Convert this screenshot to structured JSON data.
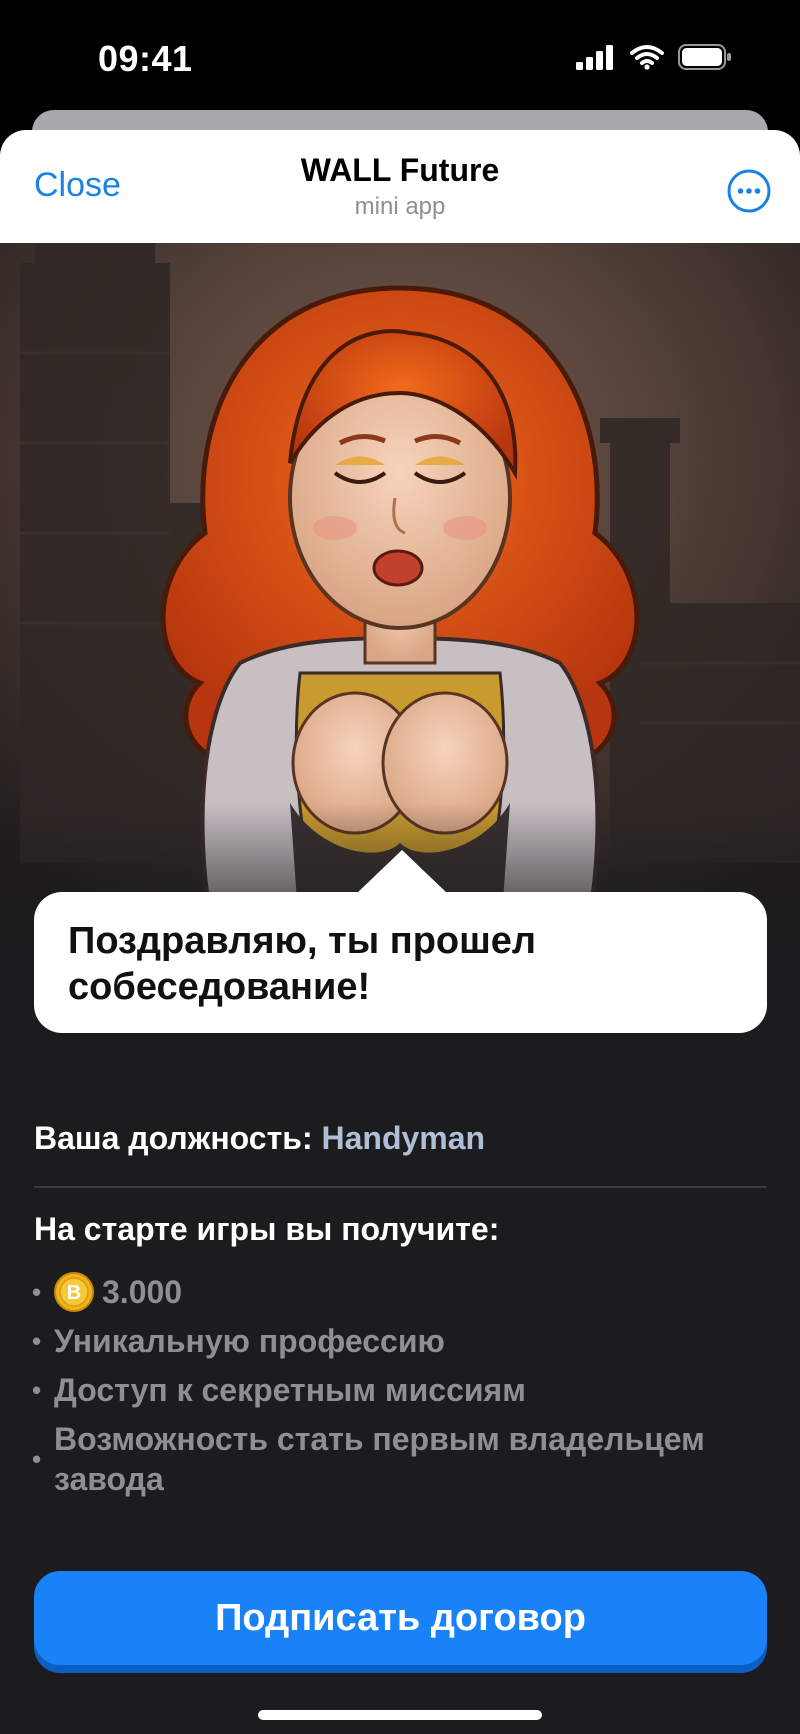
{
  "status_bar": {
    "time": "09:41"
  },
  "header": {
    "close_label": "Close",
    "title": "WALL Future",
    "subtitle": "mini app",
    "more_icon": "more-icon"
  },
  "bubble": {
    "text": "Поздравляю, ты прошел собеседование!"
  },
  "position": {
    "label": "Ваша должность:",
    "value": "Handyman"
  },
  "rewards": {
    "heading": "На старте игры вы получите:",
    "items": [
      {
        "text": "3.000",
        "icon": "coin-icon"
      },
      {
        "text": "Уникальную профессию"
      },
      {
        "text": "Доступ к секретным миссиям"
      },
      {
        "text": "Возможность стать первым владельцем завода"
      }
    ]
  },
  "cta": {
    "label": "Подписать договор"
  },
  "colors": {
    "accent": "#1a82f7",
    "link": "#1a82e4",
    "position_value": "#aebfd6",
    "sheet_bg": "#1c1c1e",
    "muted_text": "#8e8e93"
  }
}
